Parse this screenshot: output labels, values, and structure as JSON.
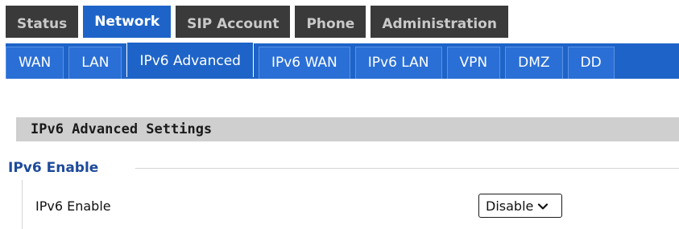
{
  "top_nav": {
    "tabs": [
      {
        "label": "Status",
        "active": false
      },
      {
        "label": "Network",
        "active": true
      },
      {
        "label": "SIP Account",
        "active": false
      },
      {
        "label": "Phone",
        "active": false
      },
      {
        "label": "Administration",
        "active": false
      }
    ]
  },
  "sub_nav": {
    "tabs": [
      {
        "label": "WAN",
        "active": false
      },
      {
        "label": "LAN",
        "active": false
      },
      {
        "label": "IPv6 Advanced",
        "active": true
      },
      {
        "label": "IPv6 WAN",
        "active": false
      },
      {
        "label": "IPv6 LAN",
        "active": false
      },
      {
        "label": "VPN",
        "active": false
      },
      {
        "label": "DMZ",
        "active": false
      },
      {
        "label": "DD",
        "active": false
      }
    ]
  },
  "section": {
    "title": "IPv6 Advanced Settings"
  },
  "group": {
    "legend": "IPv6 Enable",
    "fields": [
      {
        "label": "IPv6 Enable",
        "value": "Disable"
      }
    ]
  },
  "colors": {
    "active_tab": "#1e64c8",
    "inactive_top_tab": "#3a3a3a",
    "legend_text": "#1e4a9a",
    "section_header_bg": "#cfcfcf"
  },
  "icons": {
    "select_arrow": "chevron-down-icon"
  }
}
